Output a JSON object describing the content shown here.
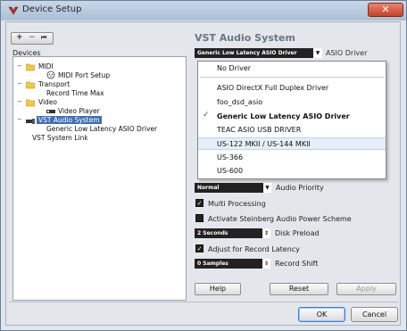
{
  "window": {
    "title": "Device Setup",
    "close_glyph": "✕"
  },
  "toolbar": {
    "add": "+",
    "remove": "−",
    "reset": "⏮"
  },
  "devices": {
    "label": "Devices",
    "tree": [
      {
        "label": "MIDI"
      },
      {
        "label": "MIDI Port Setup"
      },
      {
        "label": "Transport"
      },
      {
        "label": "Record Time Max"
      },
      {
        "label": "Video"
      },
      {
        "label": "Video Player"
      },
      {
        "label": "VST Audio System"
      },
      {
        "label": "Generic Low Latency ASIO Driver"
      },
      {
        "label": "VST System Link"
      }
    ]
  },
  "panel": {
    "title": "VST Audio System",
    "asio_driver_value": "Generic Low Latency ASIO Driver",
    "asio_driver_label": "ASIO Driver",
    "driver_options": [
      "No Driver",
      "ASIO DirectX Full Duplex Driver",
      "foo_dsd_asio",
      "Generic Low Latency ASIO Driver",
      "TEAC ASIO USB DRIVER",
      "US-122 MKII / US-144 MKII",
      "US-366",
      "US-600"
    ],
    "selected_option": "Generic Low Latency ASIO Driver",
    "audio_priority_value": "Normal",
    "audio_priority_label": "Audio Priority",
    "multi_processing_label": "Multi Processing",
    "multi_processing_checked": true,
    "power_scheme_label": "Activate Steinberg Audio Power Scheme",
    "power_scheme_checked": false,
    "disk_preload_value": "2 Seconds",
    "disk_preload_label": "Disk Preload",
    "adjust_latency_label": "Adjust for Record Latency",
    "adjust_latency_checked": true,
    "record_shift_value": "0 Samples",
    "record_shift_label": "Record Shift",
    "help_label": "Help",
    "reset_label": "Reset",
    "apply_label": "Apply"
  },
  "footer": {
    "ok_label": "OK",
    "cancel_label": "Cancel"
  },
  "colors": {
    "selection": "#3e6fb5",
    "title_gradient_top": "#c9d8e8",
    "close_red": "#c6412a"
  }
}
